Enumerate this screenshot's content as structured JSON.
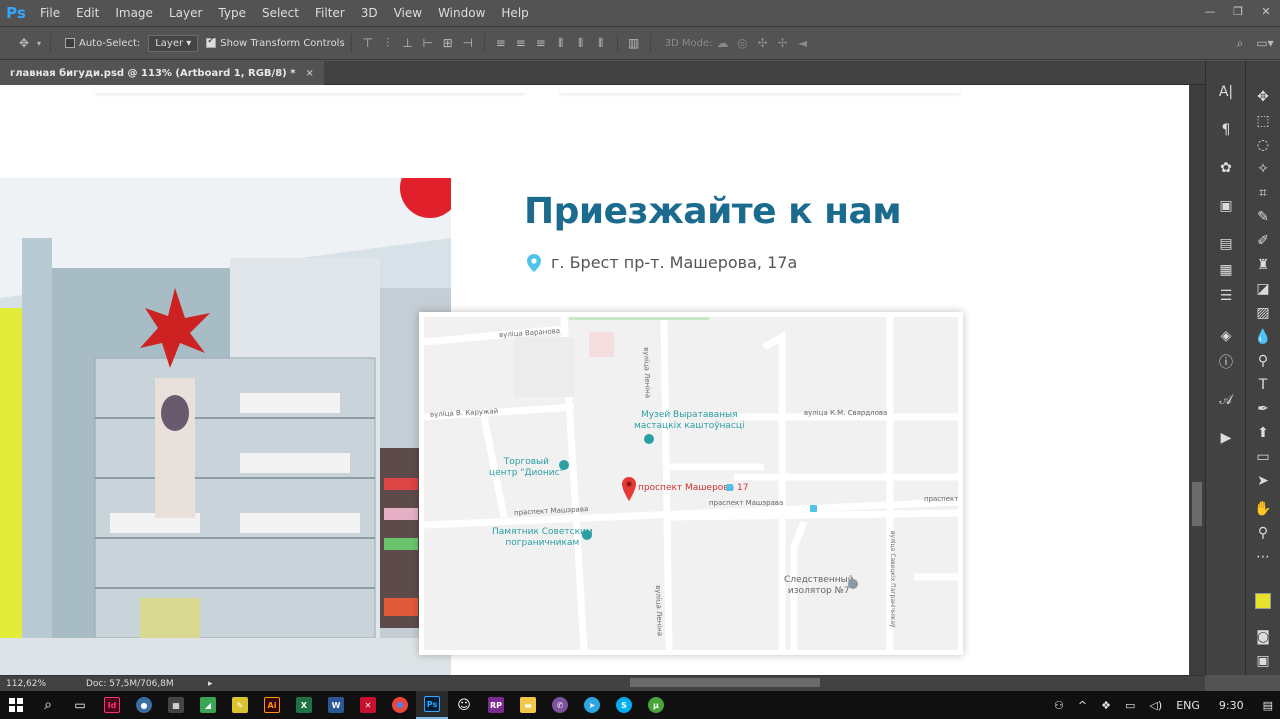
{
  "app": {
    "logo": "Ps"
  },
  "menu": [
    "File",
    "Edit",
    "Image",
    "Layer",
    "Type",
    "Select",
    "Filter",
    "3D",
    "View",
    "Window",
    "Help"
  ],
  "options": {
    "auto_select_label": "Auto-Select:",
    "layer_dropdown": "Layer",
    "show_transform_label": "Show Transform Controls",
    "mode_3d_label": "3D Mode:"
  },
  "document": {
    "tab_title": "главная бигуди.psd @ 113% (Artboard 1, RGB/8) *",
    "tab_close": "×"
  },
  "design": {
    "heading": "Приезжайте к нам",
    "address": "г. Брест пр-т. Машерова, 17а"
  },
  "map": {
    "streets": {
      "voronova": "вуліца Варанова",
      "lenina": "вуліца Леніна",
      "karuzhai": "вуліца В. Каружай",
      "sverdlova": "вуліца К.М. Свярдлова",
      "masherava1": "праспект Машэрава",
      "masherava2": "праспект Машэрава",
      "masherava3": "праспект М",
      "lenina2": "вуліца Леніна",
      "pagranichnikau": "вуліца Савецкіх Пагранічнікаў"
    },
    "poi": {
      "museum": "Музей Выратаваныя\nмастацкіх каштоўнасці",
      "dionis": "Торговый\nцентр \"Дионис\"",
      "monument": "Памятник Советским\nпограничникам",
      "isolator": "Следственный\nизолятор №7",
      "marker": "проспект Машерова 17"
    }
  },
  "status": {
    "zoom": "112,62%",
    "doc": "Doc: 57,5M/706,8M"
  },
  "taskbar": {
    "tray_lang": "ENG",
    "time": "9:30"
  },
  "colors": {
    "accent": "#1b6b8f",
    "map_marker": "#e53935",
    "poi": "#2a9fa5",
    "ps_bg": "#535353"
  }
}
